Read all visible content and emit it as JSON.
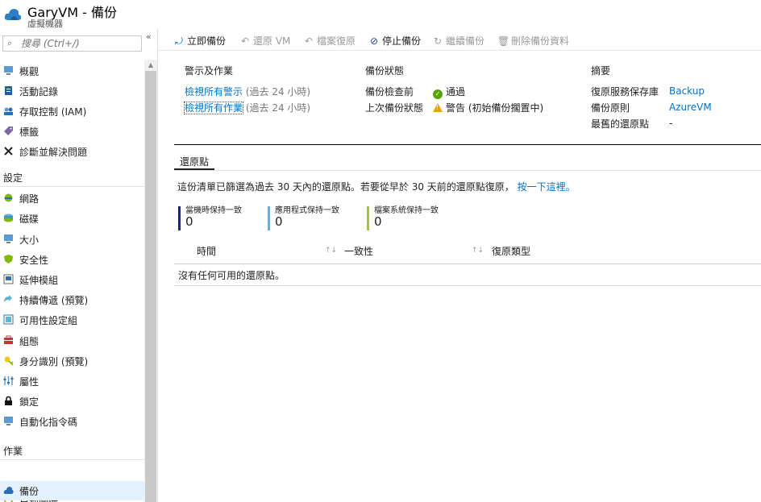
{
  "header": {
    "title": "GaryVM - 備份",
    "subtitle": "虛擬機器"
  },
  "sidebar": {
    "search_placeholder": "搜尋 (Ctrl+/)",
    "collapse_glyph": "«",
    "items_top": [
      {
        "label": "概觀",
        "icon": "overview-icon"
      },
      {
        "label": "活動記錄",
        "icon": "activity-log-icon"
      },
      {
        "label": "存取控制 (IAM)",
        "icon": "iam-icon"
      },
      {
        "label": "標籤",
        "icon": "tag-icon"
      },
      {
        "label": "診斷並解決問題",
        "icon": "wrench-icon"
      }
    ],
    "section_settings": "設定",
    "items_settings": [
      {
        "label": "網路",
        "icon": "network-icon"
      },
      {
        "label": "磁碟",
        "icon": "disk-icon"
      },
      {
        "label": "大小",
        "icon": "size-icon"
      },
      {
        "label": "安全性",
        "icon": "security-icon"
      },
      {
        "label": "延伸模組",
        "icon": "extensions-icon"
      },
      {
        "label": "持續傳遞 (預覽)",
        "icon": "continuous-delivery-icon"
      },
      {
        "label": "可用性設定組",
        "icon": "availability-set-icon"
      },
      {
        "label": "組態",
        "icon": "configuration-icon"
      },
      {
        "label": "身分識別 (預覽)",
        "icon": "identity-icon"
      },
      {
        "label": "屬性",
        "icon": "properties-icon"
      },
      {
        "label": "鎖定",
        "icon": "lock-icon"
      },
      {
        "label": "自動化指令碼",
        "icon": "automation-script-icon"
      }
    ],
    "section_operations": "作業",
    "items_operations": [
      {
        "label": "自動關機",
        "icon": "auto-shutdown-icon"
      },
      {
        "label": "備份",
        "icon": "backup-icon",
        "active": true
      }
    ]
  },
  "toolbar": {
    "backup_now": "立即備份",
    "restore_vm": "還原 VM",
    "file_recovery": "檔案復原",
    "stop_backup": "停止備份",
    "resume_backup": "繼續備份",
    "delete_backup_data": "刪除備份資料"
  },
  "alerts": {
    "heading": "警示及作業",
    "view_alerts": "檢視所有警示",
    "view_alerts_suffix": "(過去 24 小時)",
    "view_jobs": "檢視所有作業",
    "view_jobs_suffix": "(過去 24 小時)"
  },
  "backup_status": {
    "heading": "備份狀態",
    "precheck_label": "備份檢查前",
    "precheck_value": "通過",
    "last_status_label": "上次備份狀態",
    "last_status_value": "警告 (初始備份擱置中)"
  },
  "summary": {
    "heading": "摘要",
    "vault_label": "復原服務保存庫",
    "vault_value": "Backup",
    "policy_label": "備份原則",
    "policy_value": "AzureVM",
    "oldest_label": "最舊的還原點",
    "oldest_value": "-"
  },
  "restore_points": {
    "tab_label": "還原點",
    "info_text": "這份清單已篩選為過去 30 天內的還原點。若要從早於 30 天前的還原點復原，",
    "info_link": "按一下這裡。",
    "tiles": [
      {
        "label": "當機時保持一致",
        "value": "0",
        "color": "#1a237e"
      },
      {
        "label": "應用程式保持一致",
        "value": "0",
        "color": "#6aaed6"
      },
      {
        "label": "檔案系統保持一致",
        "value": "0",
        "color": "#a3c43f"
      }
    ],
    "columns": [
      "時間",
      "一致性",
      "復原類型"
    ],
    "sort_glyph": "↑↓",
    "empty_message": "沒有任何可用的還原點。"
  }
}
